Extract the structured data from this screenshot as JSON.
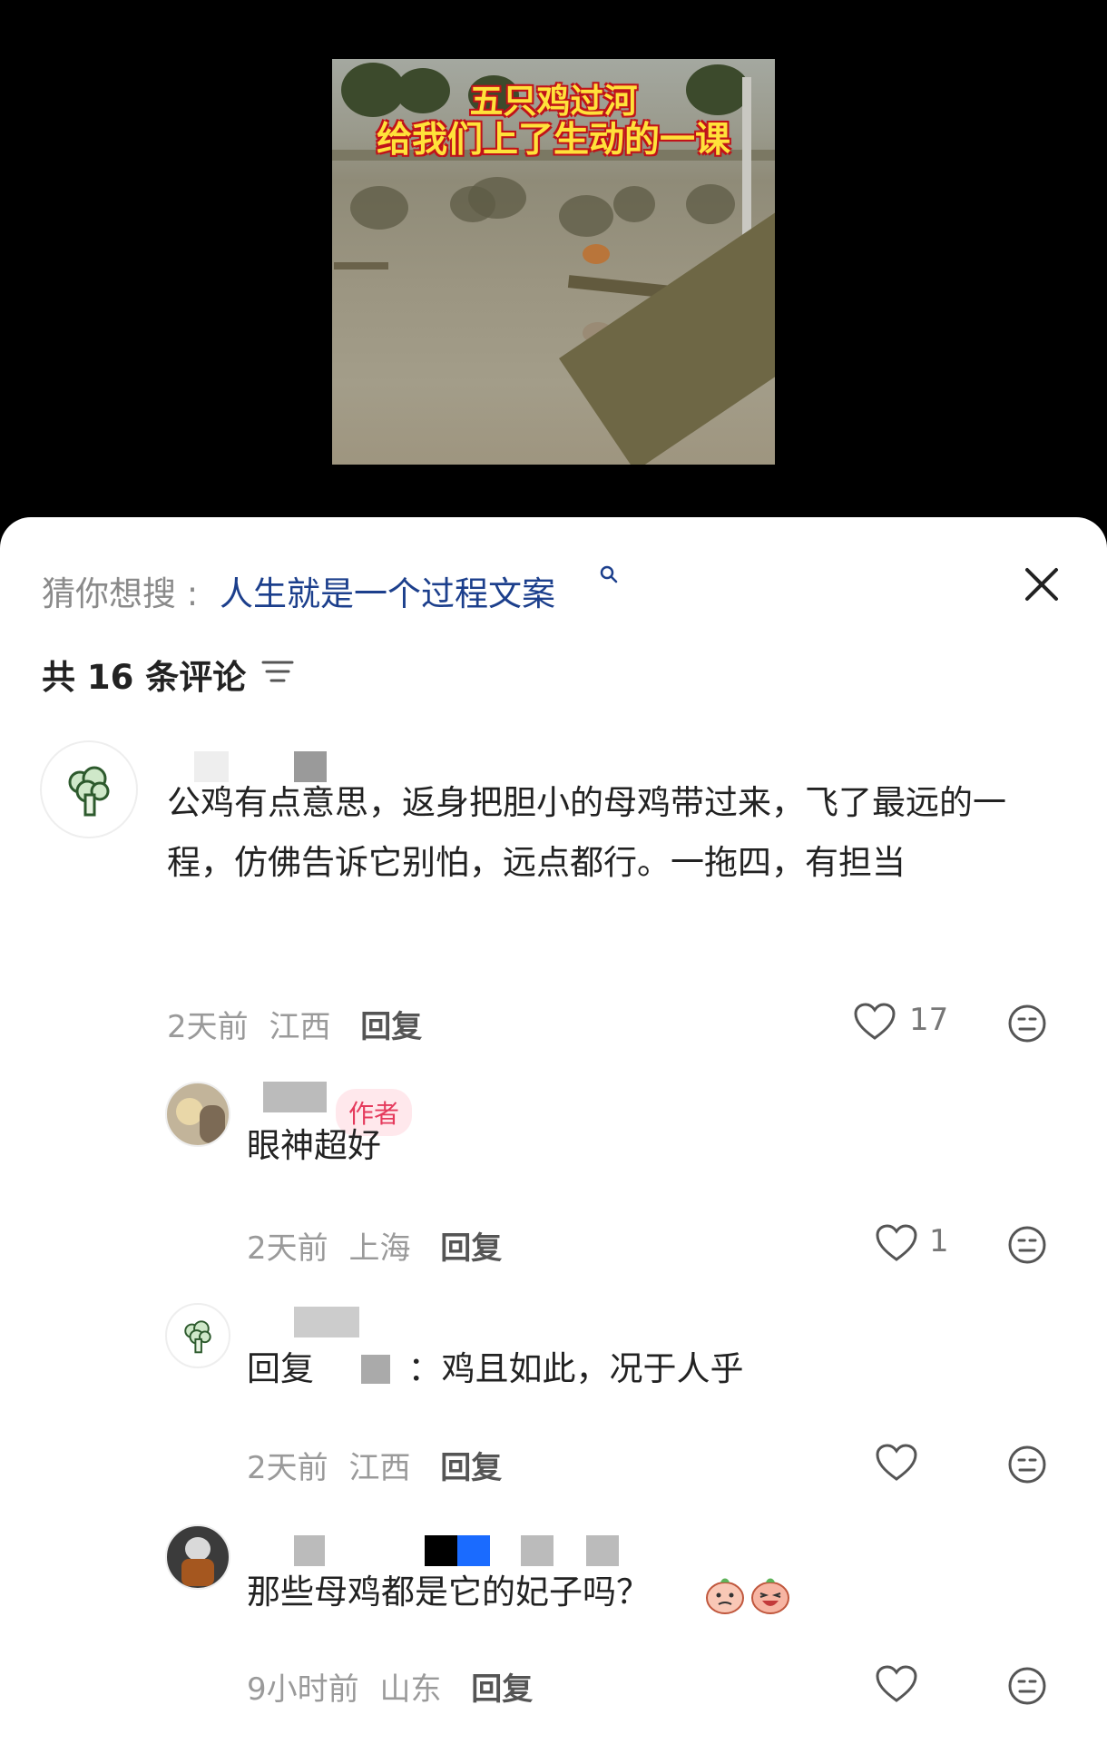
{
  "video": {
    "caption_line1": "五只鸡过河",
    "caption_line2": "给我们上了生动的一课"
  },
  "sheet": {
    "suggest_prefix": "猜你想搜 :",
    "suggest_query": "人生就是一个过程文案",
    "comment_count_label": "共 16 条评论",
    "icons": [
      "search-icon",
      "close-icon",
      "filter-icon",
      "heart-icon",
      "reaction-face-icon"
    ]
  },
  "comments": [
    {
      "text": "公鸡有点意思，返身把胆小的母鸡带过来，飞了最远的一程，仿佛告诉它别怕，远点都行。一拖四，有担当",
      "time": "2天前",
      "location": "江西",
      "reply_label": "回复",
      "likes": "17"
    },
    {
      "badge": "作者",
      "text": "眼神超好",
      "time": "2天前",
      "location": "上海",
      "reply_label": "回复",
      "likes": "1"
    },
    {
      "reply_prefix": "回复",
      "text": "：鸡且如此，况于人乎",
      "time": "2天前",
      "location": "江西",
      "reply_label": "回复",
      "likes": ""
    },
    {
      "text": "那些母鸡都是它的妃子吗？",
      "time": "9小时前",
      "location": "山东",
      "reply_label": "回复",
      "likes": ""
    }
  ]
}
